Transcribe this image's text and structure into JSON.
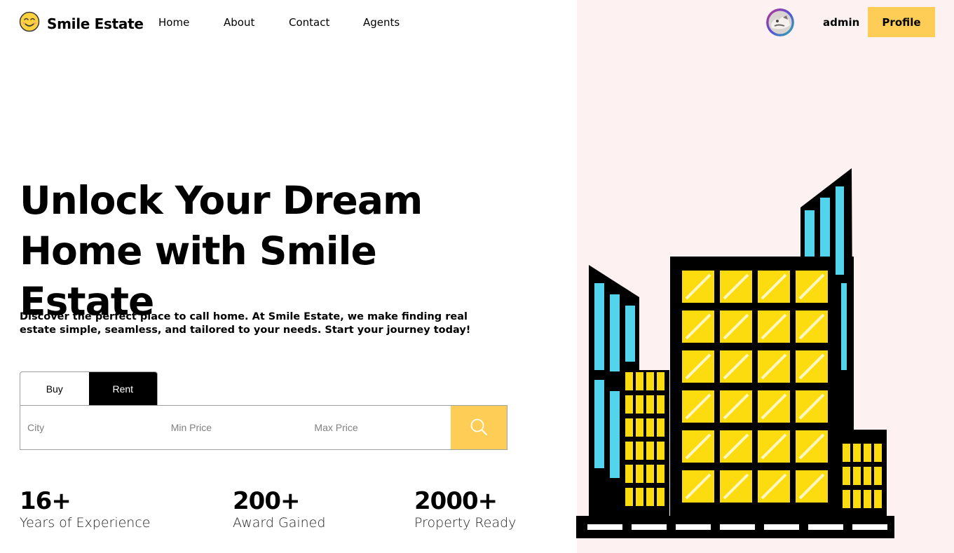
{
  "brand": {
    "name": "Smile Estate",
    "icon": "smile-face-icon"
  },
  "nav": {
    "items": [
      "Home",
      "About",
      "Contact",
      "Agents"
    ]
  },
  "user": {
    "name": "admin",
    "profile_label": "Profile"
  },
  "hero": {
    "title_line1": "Unlock Your Dream",
    "title_line2": "Home with Smile Estate",
    "description": "Discover the perfect place to call home. At Smile Estate, we make finding real estate simple, seamless, and tailored to your needs. Start your journey today!"
  },
  "search": {
    "tabs": [
      {
        "label": "Buy",
        "active": false
      },
      {
        "label": "Rent",
        "active": true
      }
    ],
    "city_placeholder": "City",
    "min_price_placeholder": "Min Price",
    "max_price_placeholder": "Max Price",
    "button_icon": "search-icon"
  },
  "stats": [
    {
      "value": "16+",
      "label": "Years of Experience"
    },
    {
      "value": "200+",
      "label": "Award Gained"
    },
    {
      "value": "2000+",
      "label": "Property Ready"
    }
  ],
  "colors": {
    "accent": "#fecd55",
    "right_panel": "#fdf2f1",
    "window_yellow": "#fddc0f",
    "window_blue": "#52d4ec"
  }
}
